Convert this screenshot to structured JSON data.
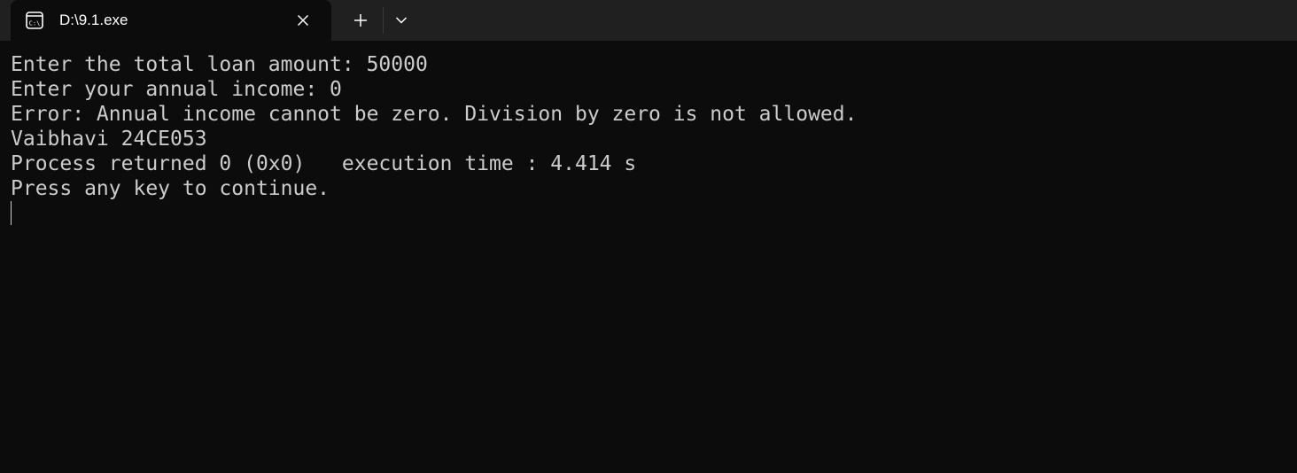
{
  "tab": {
    "title": "D:\\9.1.exe",
    "icon": "console-icon",
    "close_icon": "close-icon"
  },
  "toolbar": {
    "new_tab_icon": "plus-icon",
    "dropdown_icon": "chevron-down-icon"
  },
  "terminal": {
    "lines": [
      "Enter the total loan amount: 50000",
      "Enter your annual income: 0",
      "Error: Annual income cannot be zero. Division by zero is not allowed.",
      "Vaibhavi 24CE053",
      "Process returned 0 (0x0)   execution time : 4.414 s",
      "Press any key to continue."
    ]
  },
  "colors": {
    "background": "#0c0c0c",
    "tabbar": "#202020",
    "text": "#cccccc"
  }
}
